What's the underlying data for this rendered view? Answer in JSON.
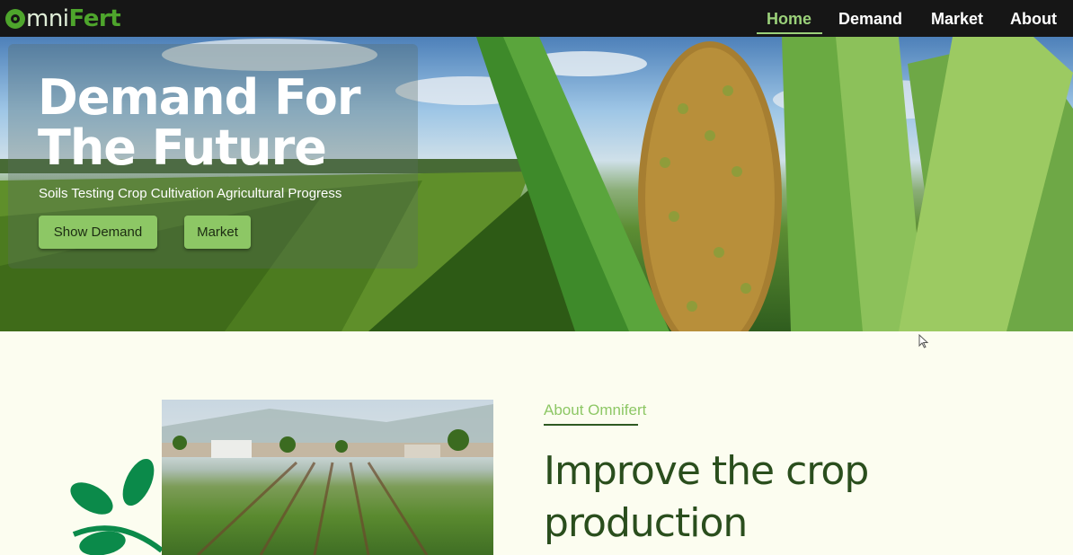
{
  "brand": {
    "name_part1": "mni",
    "name_part2": "Fert",
    "accent": "#4ea52c"
  },
  "nav": {
    "items": [
      {
        "label": "Home",
        "active": true
      },
      {
        "label": "Demand",
        "active": false
      },
      {
        "label": "Market",
        "active": false
      },
      {
        "label": "About",
        "active": false
      }
    ]
  },
  "hero": {
    "title": "Demand For The Future",
    "subtitle": "Soils Testing Crop Cultivation Agricultural Progress",
    "primary_button": "Show Demand",
    "secondary_button": "Market",
    "button_color": "#8dc765"
  },
  "about": {
    "label": "About Omnifert",
    "heading": "Improve the crop production",
    "heading_color": "#2a4e1d",
    "label_color": "#8dc765"
  }
}
